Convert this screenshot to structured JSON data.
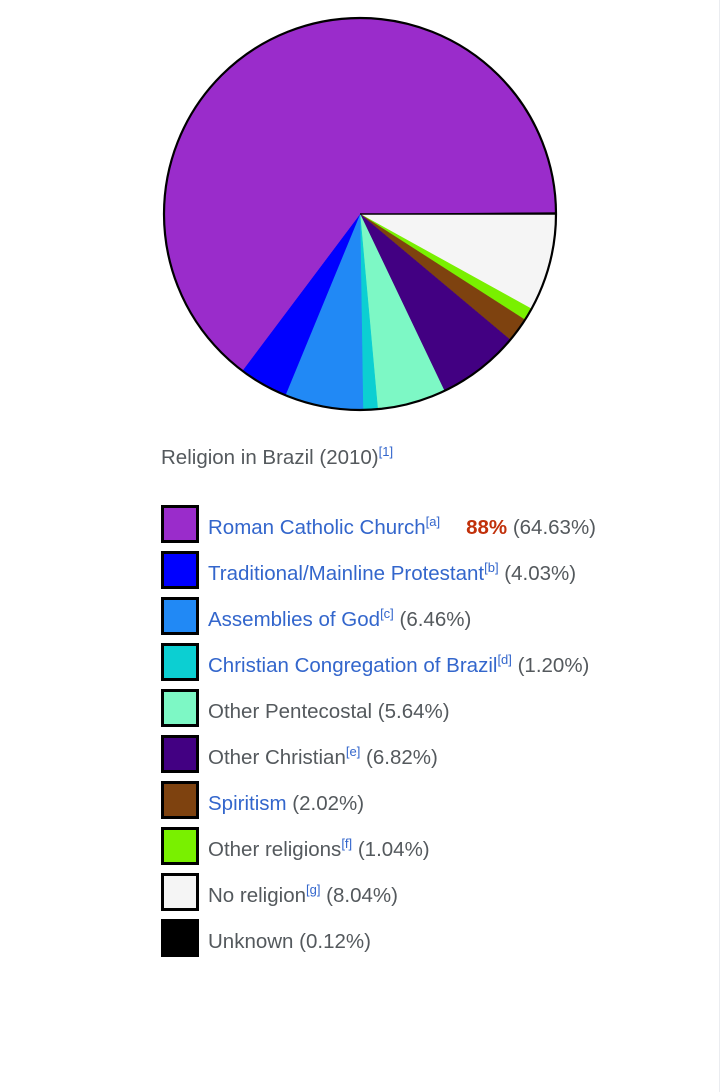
{
  "caption": {
    "text": "Religion in Brazil (2010)",
    "ref": "[1]"
  },
  "annotation": {
    "value": "88%",
    "color": "#c1300a"
  },
  "colors": {
    "link": "#3366cc",
    "text": "#54595d",
    "annotation_red": "#c1300a",
    "pie_outline": "#000000"
  },
  "chart_data": {
    "type": "pie",
    "title": "Religion in Brazil (2010)",
    "start_angle_deg": 0,
    "direction": "clockwise",
    "legend_position": "below",
    "grid": false,
    "categories": [
      "Roman Catholic Church",
      "Traditional/Mainline Protestant",
      "Assemblies of God",
      "Christian Congregation of Brazil",
      "Other Pentecostal",
      "Other Christian",
      "Spiritism",
      "Other religions",
      "No religion",
      "Unknown"
    ],
    "values": [
      64.63,
      4.03,
      6.46,
      1.2,
      5.64,
      6.82,
      2.02,
      1.04,
      8.04,
      0.12
    ],
    "colors": [
      "#9a2ccb",
      "#0000ff",
      "#2189f5",
      "#0ccfd2",
      "#7df8c5",
      "#420082",
      "#7e420f",
      "#79f000",
      "#f5f5f5",
      "#000000"
    ],
    "slice_order_clockwise_from_3oclock": [
      "No religion",
      "Other religions",
      "Spiritism",
      "Other Christian",
      "Other Pentecostal",
      "Christian Congregation of Brazil",
      "Assemblies of God",
      "Traditional/Mainline Protestant",
      "Roman Catholic Church",
      "Unknown"
    ]
  },
  "legend": {
    "items": [
      {
        "color": "#9a2ccb",
        "label": "Roman Catholic Church",
        "ref": "[a]",
        "is_link": true,
        "percent": "(64.63%)",
        "annotation": "88%"
      },
      {
        "color": "#0000ff",
        "label": "Traditional/Mainline Protestant",
        "ref": "[b]",
        "is_link": true,
        "percent": "(4.03%)",
        "annotation": ""
      },
      {
        "color": "#2189f5",
        "label": "Assemblies of God",
        "ref": "[c]",
        "is_link": true,
        "percent": "(6.46%)",
        "annotation": ""
      },
      {
        "color": "#0ccfd2",
        "label": "Christian Congregation of Brazil",
        "ref": "[d]",
        "is_link": true,
        "percent": "(1.20%)",
        "annotation": ""
      },
      {
        "color": "#7df8c5",
        "label": "Other Pentecostal",
        "ref": "",
        "is_link": false,
        "percent": "(5.64%)",
        "annotation": ""
      },
      {
        "color": "#420082",
        "label": "Other Christian",
        "ref": "[e]",
        "is_link": false,
        "percent": "(6.82%)",
        "annotation": ""
      },
      {
        "color": "#7e420f",
        "label": "Spiritism",
        "ref": "",
        "is_link": true,
        "percent": "(2.02%)",
        "annotation": ""
      },
      {
        "color": "#79f000",
        "label": "Other religions",
        "ref": "[f]",
        "is_link": false,
        "percent": "(1.04%)",
        "annotation": ""
      },
      {
        "color": "#f5f5f5",
        "label": "No religion",
        "ref": "[g]",
        "is_link": false,
        "percent": "(8.04%)",
        "annotation": ""
      },
      {
        "color": "#000000",
        "label": "Unknown",
        "ref": "",
        "is_link": false,
        "percent": "(0.12%)",
        "annotation": ""
      }
    ]
  }
}
